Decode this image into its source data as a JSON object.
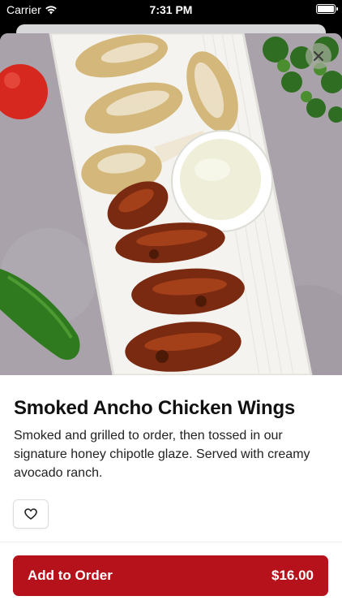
{
  "status_bar": {
    "carrier": "Carrier",
    "time": "7:31 PM"
  },
  "product": {
    "title": "Smoked Ancho Chicken Wings",
    "description": "Smoked and grilled to order, then tossed in our signature honey chipotle glaze. Served with creamy avocado ranch."
  },
  "actions": {
    "add_to_order_label": "Add to Order",
    "price": "$16.00"
  },
  "icons": {
    "wifi": "wifi-icon",
    "battery": "battery-icon",
    "close": "close-icon",
    "favorite": "heart-icon"
  },
  "colors": {
    "accent": "#b5121b",
    "background": "#ffffff",
    "status_bar": "#000000"
  }
}
